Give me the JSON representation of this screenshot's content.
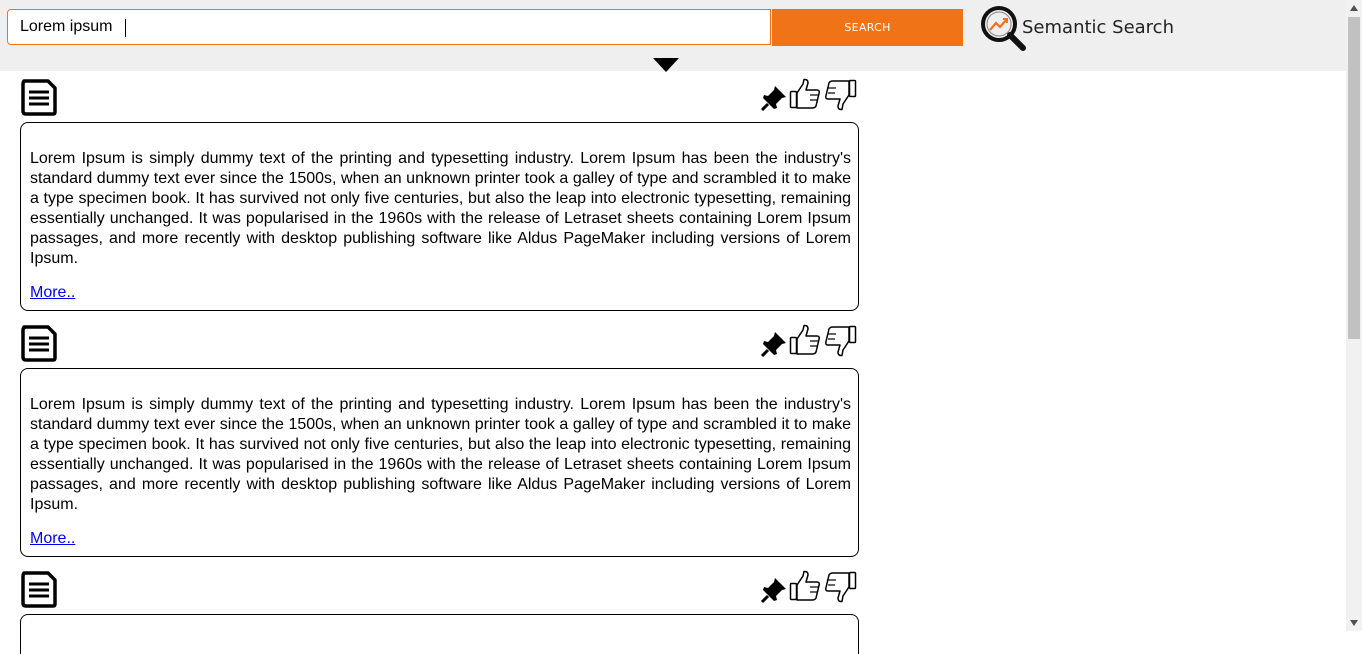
{
  "search": {
    "value": "Lorem ipsum ",
    "button_label": "SEARCH"
  },
  "logo": {
    "text": "Semantic Search",
    "icon": "magnifier-trend-icon"
  },
  "colors": {
    "accent": "#f07417",
    "topbar_bg": "#efefef",
    "link": "#0000ee"
  },
  "results": [
    {
      "text": "Lorem Ipsum is simply dummy text of the printing and typesetting industry. Lorem Ipsum has been the industry's standard dummy text ever since the 1500s, when an unknown printer took a galley of type and scrambled it to make a type specimen book. It has survived not only five centuries, but also the leap into electronic typesetting, remaining essentially unchanged. It was popularised in the 1960s with the release of Letraset sheets containing Lorem Ipsum passages, and more recently with desktop publishing software like Aldus PageMaker including versions of Lorem Ipsum.",
      "more": "More.."
    },
    {
      "text": "Lorem Ipsum is simply dummy text of the printing and typesetting industry. Lorem Ipsum has been the industry's standard dummy text ever since the 1500s, when an unknown printer took a galley of type and scrambled it to make a type specimen book. It has survived not only five centuries, but also the leap into electronic typesetting, remaining essentially unchanged. It was popularised in the 1960s with the release of Letraset sheets containing Lorem Ipsum passages, and more recently with desktop publishing software like Aldus PageMaker including versions of Lorem Ipsum.",
      "more": "More.."
    },
    {
      "text": "",
      "more": ""
    }
  ]
}
